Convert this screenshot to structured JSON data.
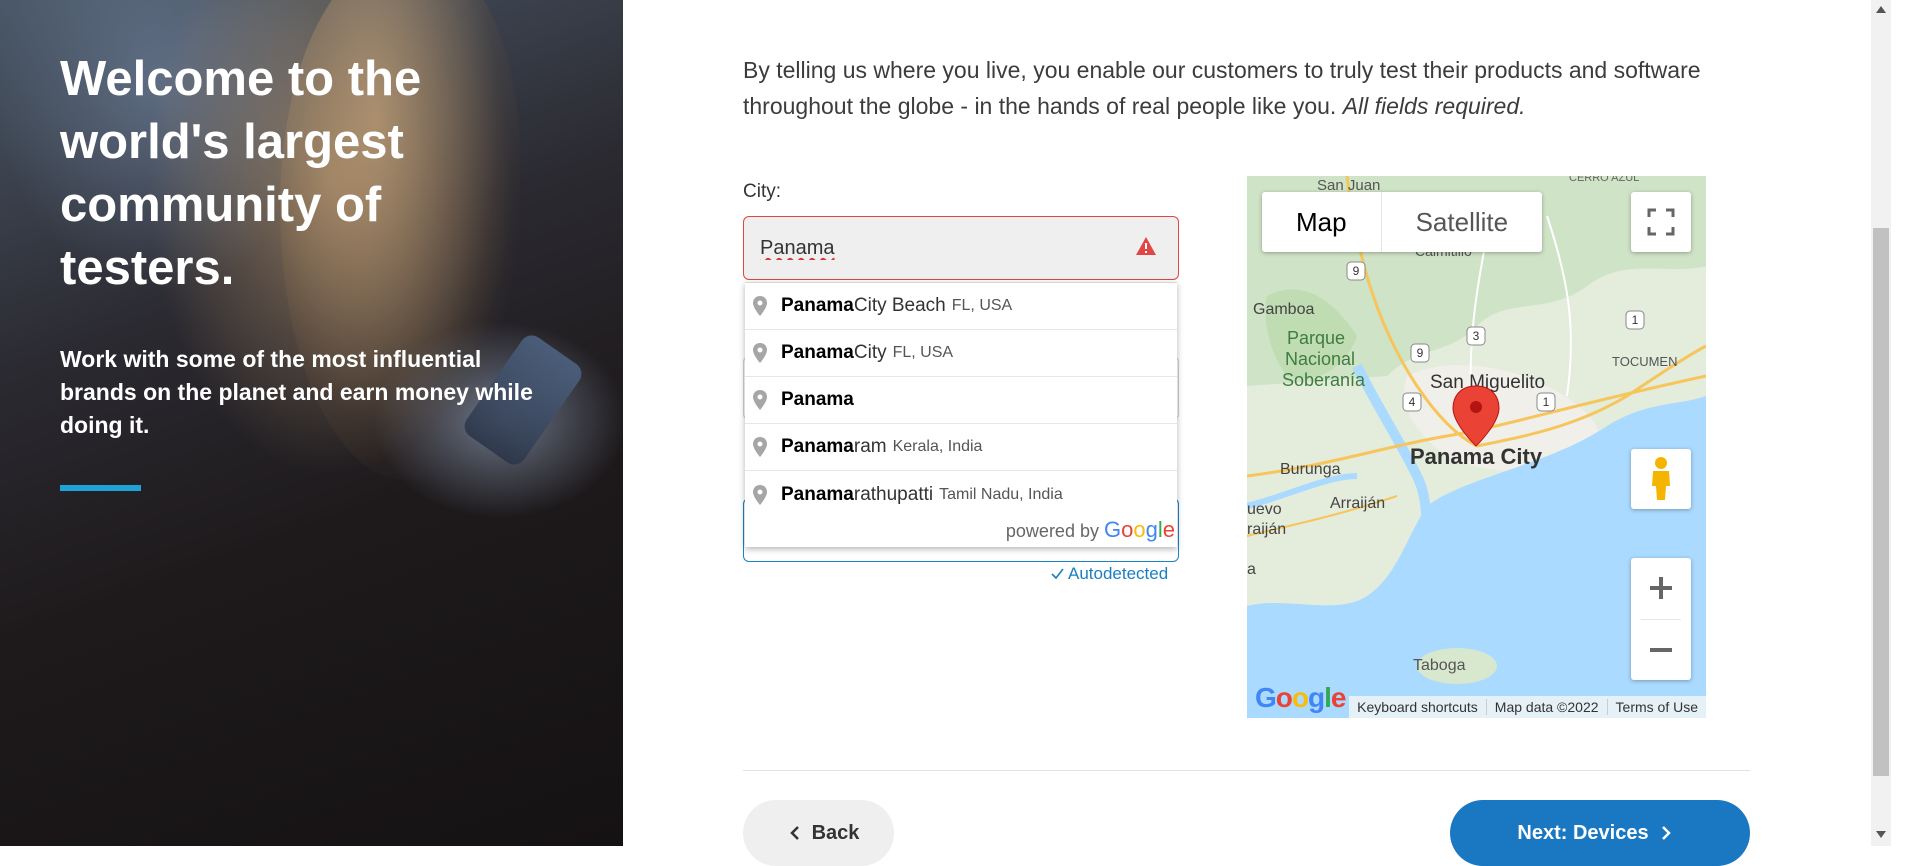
{
  "hero": {
    "title": "Welcome to the world's largest community of testers.",
    "subtitle": "Work with some of the most influential brands on the planet and earn money while doing it.",
    "accent_color": "#1fa3d6"
  },
  "form": {
    "intro": "By telling us where you live, you enable our customers to truly test their products and software throughout the globe - in the hands of real people like you.",
    "intro_emphasis": "All fields required.",
    "city_label": "City:",
    "city_value": "Panama",
    "autodetected": "Autodetected"
  },
  "autocomplete": {
    "items": [
      {
        "match": "Panama",
        "rest": " City Beach",
        "secondary": "FL, USA"
      },
      {
        "match": "Panama",
        "rest": " City",
        "secondary": "FL, USA"
      },
      {
        "match": "Panama",
        "rest": "",
        "secondary": ""
      },
      {
        "match": "Panama",
        "rest": "ram",
        "secondary": "Kerala, India"
      },
      {
        "match": "Panama",
        "rest": "rathupatti",
        "secondary": "Tamil Nadu, India"
      }
    ],
    "powered_by": "powered by",
    "google": "Google"
  },
  "map": {
    "type_map": "Map",
    "type_satellite": "Satellite",
    "labels": {
      "san_juan": "San Juan",
      "cerro_azul": "CERRO AZUL",
      "calmitillo": "Calmitillo",
      "gamboa": "Gamboa",
      "parque": "Parque",
      "nacional": "Nacional",
      "soberania": "Soberanía",
      "tocumen": "TOCUMEN",
      "san_miguelito": "San Miguelito",
      "panama_city": "Panama City",
      "burunga": "Burunga",
      "arraijan": "Arraiján",
      "nuevo": "uevo",
      "arraijan_cut": "raiján",
      "a_cut": "a",
      "taboga": "Taboga"
    },
    "shields": [
      "9",
      "9",
      "3",
      "1",
      "4",
      "1"
    ],
    "attribution": {
      "shortcuts": "Keyboard shortcuts",
      "data": "Map data ©2022",
      "terms": "Terms of Use"
    },
    "google_logo": "Google"
  },
  "nav": {
    "back": "Back",
    "next": "Next: Devices"
  }
}
